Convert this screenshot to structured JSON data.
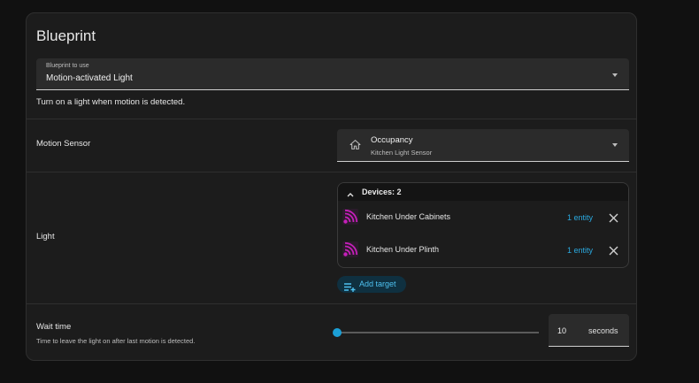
{
  "card": {
    "title": "Blueprint"
  },
  "blueprint_select": {
    "label": "Blueprint to use",
    "value": "Motion-activated Light",
    "description": "Turn on a light when motion is detected."
  },
  "motion_sensor": {
    "label": "Motion Sensor",
    "entity_name": "Occupancy",
    "entity_device": "Kitchen Light Sensor",
    "icon": "home-icon"
  },
  "light": {
    "label": "Light",
    "devices_header": "Devices: 2",
    "devices": [
      {
        "name": "Kitchen Under Cabinets",
        "count": "1 entity",
        "icon": "light-wave-icon"
      },
      {
        "name": "Kitchen Under Plinth",
        "count": "1 entity",
        "icon": "light-wave-icon"
      }
    ],
    "add_target_label": "Add target"
  },
  "wait_time": {
    "label": "Wait time",
    "description": "Time to leave the light on after last motion is detected.",
    "value": "10",
    "unit": "seconds",
    "slider_fraction": 0.0
  },
  "colors": {
    "accent": "#1b9fd6",
    "link": "#2aa9e0",
    "device_icon": "#c51fb9",
    "card_bg": "#1c1c1c"
  }
}
